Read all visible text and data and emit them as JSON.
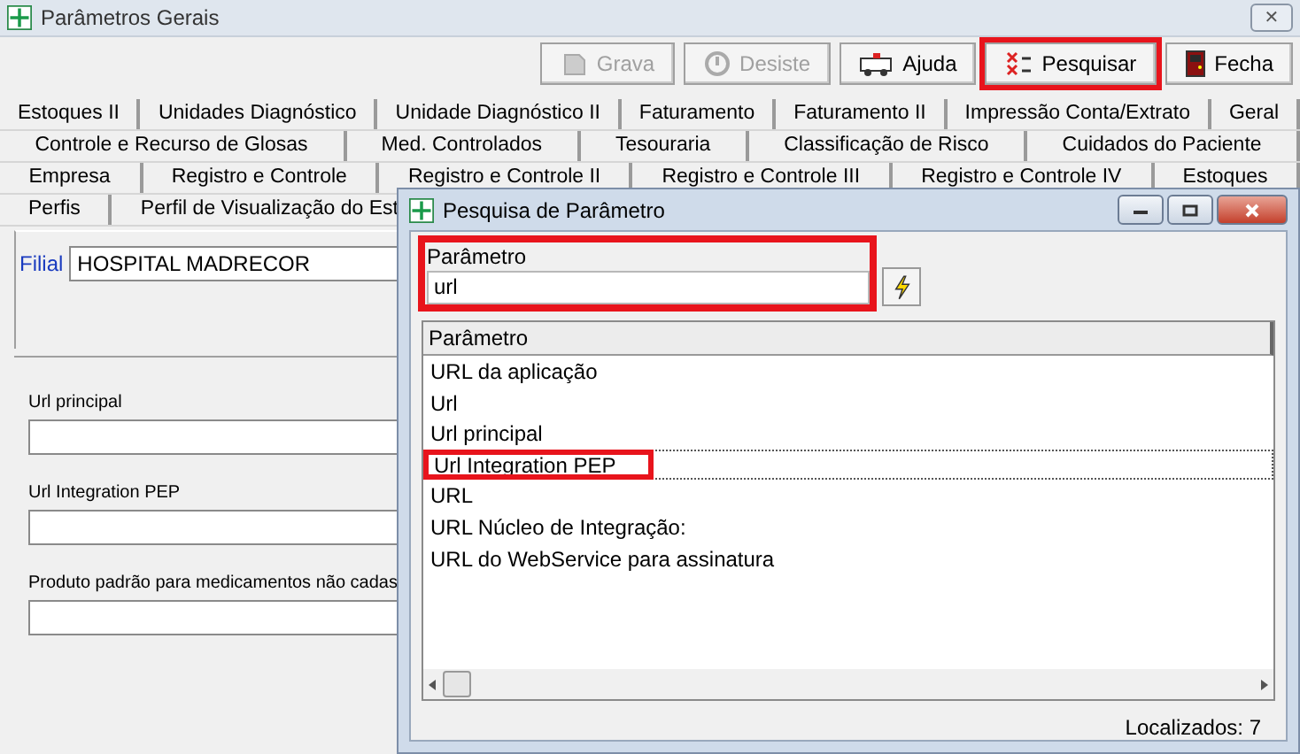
{
  "window": {
    "title": "Parâmetros Gerais",
    "close": "✕"
  },
  "toolbar": [
    {
      "label": "Grava",
      "kind": "save",
      "disabled": true,
      "highlighted": false
    },
    {
      "label": "Desiste",
      "kind": "cancel",
      "disabled": true,
      "highlighted": false
    },
    {
      "label": "Ajuda",
      "kind": "help",
      "disabled": false,
      "highlighted": false
    },
    {
      "label": "Pesquisar",
      "kind": "search",
      "disabled": false,
      "highlighted": true
    },
    {
      "label": "Fecha",
      "kind": "exit",
      "disabled": false,
      "highlighted": false
    }
  ],
  "tab_rows": [
    [
      "Estoques II",
      "Unidades Diagnóstico",
      "Unidade Diagnóstico II",
      "Faturamento",
      "Faturamento II",
      "Impressão Conta/Extrato",
      "Geral"
    ],
    [
      "Controle e Recurso de Glosas",
      "Med. Controlados",
      "Tesouraria",
      "Classificação de Risco",
      "Cuidados do Paciente"
    ],
    [
      "Empresa",
      "Registro e Controle",
      "Registro e Controle II",
      "Registro e Controle III",
      "Registro e Controle IV",
      "Estoques"
    ],
    [
      "Perfis",
      "Perfil de Visualização do Est"
    ]
  ],
  "filial": {
    "label": "Filial",
    "value": "HOSPITAL MADRECOR"
  },
  "fields": [
    {
      "label": "Url principal"
    },
    {
      "label": "Url Integration PEP"
    },
    {
      "label": "Produto padrão para medicamentos não cadas"
    }
  ],
  "dialog": {
    "title": "Pesquisa de Parâmetro",
    "search": {
      "label": "Parâmetro",
      "value": "url",
      "highlighted": true
    },
    "column": "Parâmetro",
    "rows": [
      {
        "text": "URL da aplicação",
        "selected": false,
        "highlighted": false
      },
      {
        "text": "Url",
        "selected": false,
        "highlighted": false
      },
      {
        "text": "Url principal",
        "selected": false,
        "highlighted": false
      },
      {
        "text": "Url Integration PEP",
        "selected": true,
        "highlighted": true
      },
      {
        "text": "URL",
        "selected": false,
        "highlighted": false
      },
      {
        "text": "URL Núcleo de Integração:",
        "selected": false,
        "highlighted": false
      },
      {
        "text": "URL do WebService para assinatura",
        "selected": false,
        "highlighted": false
      }
    ],
    "status": "Localizados: 7"
  }
}
